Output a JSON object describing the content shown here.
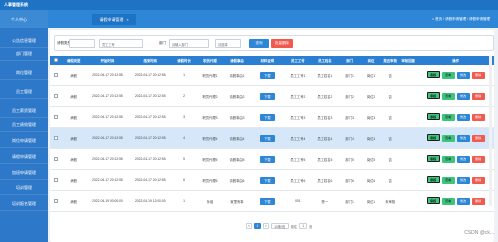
{
  "app": {
    "title": "人事管理系统",
    "user_label": ""
  },
  "sidebar": {
    "head": "个人中心",
    "items": [
      {
        "label": "公告信息管理"
      },
      {
        "label": "部门管理"
      },
      {
        "label": "岗位管理"
      },
      {
        "label": "员工管理"
      },
      {
        "label": "员工薪资管理"
      },
      {
        "label": "员工绩效管理"
      },
      {
        "label": "岗位申请管理"
      },
      {
        "label": "请假申请管理"
      },
      {
        "label": "加班申请管理"
      },
      {
        "label": "培训管理"
      },
      {
        "label": "培训报名管理"
      }
    ]
  },
  "tabs": [
    {
      "label": "请假申请管理"
    }
  ],
  "breadcrumb": "首页 / 请假申请管理 / 请假申请管理",
  "search": {
    "label1": "请假类型",
    "select1": "",
    "label2": "员工工号",
    "input2_placeholder": "员工工号",
    "label3": "部门",
    "input3_placeholder": "请输入部门",
    "label4": "",
    "select4": "请选择",
    "search_button": "查询",
    "delete_button": "批量删除"
  },
  "table": {
    "columns": [
      "",
      "请假类型",
      "开始时间",
      "结束时间",
      "请假时长",
      "职员代理",
      "请假事由",
      "材料证明",
      "员工工号",
      "员工姓名",
      "部门",
      "岗位",
      "是否审核",
      "审核回复",
      "操作"
    ],
    "rows": [
      {
        "type": "病假",
        "start": "2022-04-17 20:12:55",
        "end": "2022-04-17 20:12:55",
        "hours": "1",
        "agent": "职员代理1",
        "reason": "请假事由1",
        "file": "下载",
        "emp_no": "员工工号1",
        "emp_name": "员工姓名1",
        "dept": "部门1",
        "post": "岗位1",
        "audit": "否",
        "reply": ""
      },
      {
        "type": "病假",
        "start": "2022-04-17 20:12:55",
        "end": "2022-04-17 20:12:55",
        "hours": "2",
        "agent": "职员代理2",
        "reason": "请假事由2",
        "file": "下载",
        "emp_no": "员工工号2",
        "emp_name": "员工姓名2",
        "dept": "部门2",
        "post": "岗位2",
        "audit": "否",
        "reply": ""
      },
      {
        "type": "病假",
        "start": "2022-04-17 20:12:55",
        "end": "2022-04-17 20:12:55",
        "hours": "3",
        "agent": "职员代理3",
        "reason": "请假事由3",
        "file": "下载",
        "emp_no": "员工工号3",
        "emp_name": "员工姓名3",
        "dept": "部门3",
        "post": "岗位3",
        "audit": "否",
        "reply": ""
      },
      {
        "type": "病假",
        "start": "2022-04-17 20:12:55",
        "end": "2022-04-17 20:12:55",
        "hours": "4",
        "agent": "职员代理4",
        "reason": "请假事由4",
        "file": "下载",
        "emp_no": "员工工号4",
        "emp_name": "员工姓名4",
        "dept": "部门4",
        "post": "岗位4",
        "audit": "否",
        "reply": ""
      },
      {
        "type": "病假",
        "start": "2022-04-17 20:12:55",
        "end": "2022-04-17 20:12:55",
        "hours": "5",
        "agent": "职员代理5",
        "reason": "请假事由5",
        "file": "下载",
        "emp_no": "员工工号5",
        "emp_name": "员工姓名5",
        "dept": "部门5",
        "post": "岗位5",
        "audit": "否",
        "reply": ""
      },
      {
        "type": "病假",
        "start": "2022-04-17 20:12:55",
        "end": "2022-04-17 20:12:55",
        "hours": "6",
        "agent": "职员代理6",
        "reason": "请假事由6",
        "file": "下载",
        "emp_no": "员工工号6",
        "emp_name": "员工姓名6",
        "dept": "部门6",
        "post": "岗位6",
        "audit": "否",
        "reply": ""
      },
      {
        "type": "病假",
        "start": "2022-04-19 00:00:00",
        "end": "2022-04-19 12:00:00",
        "hours": "1",
        "agent": "孙组",
        "reason": "家里有事",
        "file": "下载",
        "emp_no": "001",
        "emp_name": "陈一",
        "dept": "部门1",
        "post": "岗位1",
        "audit": "未审核",
        "reply": ""
      }
    ],
    "actions": {
      "review": "审核",
      "view": "查看",
      "edit": "修改",
      "delete": "删除"
    }
  },
  "pager": {
    "prev": "<",
    "page": "1",
    "next": ">",
    "size": "10条/页",
    "goto_label": "前往",
    "goto_value": "1",
    "page_label": "页"
  },
  "watermark": "CSDN @ck...",
  "colors": {
    "primary": "#2e86d6",
    "sidebar": "#2d78c8",
    "header": "#1f73c4",
    "success": "#3ec57d",
    "danger": "#f05a4f"
  }
}
